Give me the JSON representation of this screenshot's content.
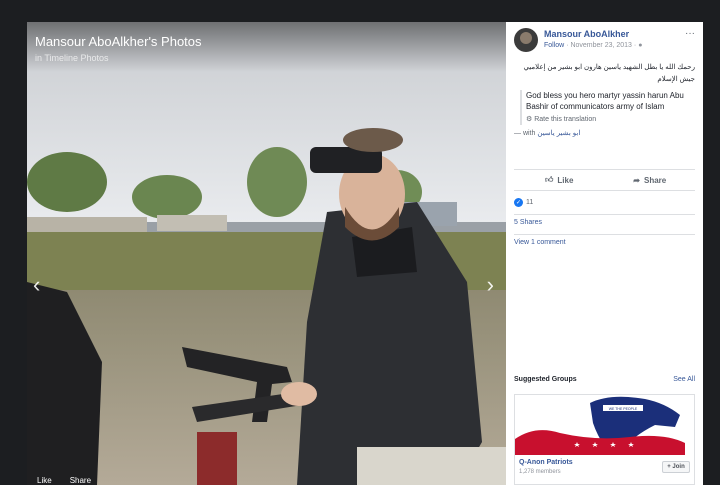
{
  "viewer": {
    "album_title": "Mansour AboAlkher's Photos",
    "album_subtitle": "in Timeline Photos",
    "prev_arrow": "‹",
    "next_arrow": "›",
    "footer_like": "Like",
    "footer_share": "Share"
  },
  "post": {
    "author": "Mansour AboAlkher",
    "follow_label": "Follow",
    "date": "November 23, 2013",
    "more": "···",
    "arabic_text": "رحمك الله يا بطل الشهيد ياسين هارون ابو بشير من إعلاميي جيش الإسلام",
    "translation": "God bless you hero martyr yassin harun Abu Bashir of communicators army of Islam",
    "rate_translation": "Rate this translation",
    "with_prefix": "— with",
    "tagged_name": "ابو بشير ياسين",
    "like_label": "Like",
    "share_label": "Share",
    "reaction_count": "11",
    "shares": "5 Shares",
    "comments": "View 1 comment"
  },
  "suggested": {
    "title": "Suggested Groups",
    "see_all": "See All",
    "group_name": "Q-Anon Patriots",
    "group_members": "1,278 members",
    "join_label": "+ Join",
    "banner_text": "WE THE PEOPLE"
  },
  "icons": {
    "globe": "globe-icon",
    "gear": "gear-icon",
    "like": "thumbs-up-icon",
    "share": "share-arrow-icon"
  },
  "colors": {
    "background": "#1c1e21",
    "link": "#385898",
    "like_blue": "#1877f2"
  }
}
